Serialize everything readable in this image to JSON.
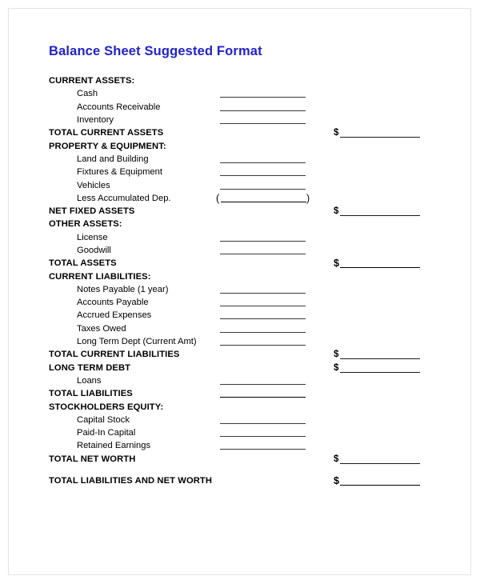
{
  "document": {
    "title": "Balance Sheet Suggested Format",
    "title_color": "#2222CC",
    "currency_symbol": "$"
  },
  "rows": [
    {
      "label": "CURRENT ASSETS:",
      "kind": "header",
      "field": "none"
    },
    {
      "label": "Cash",
      "kind": "item",
      "field": "inner"
    },
    {
      "label": "Accounts Receivable",
      "kind": "item",
      "field": "inner"
    },
    {
      "label": "Inventory",
      "kind": "item",
      "field": "inner"
    },
    {
      "label": "TOTAL CURRENT ASSETS",
      "kind": "total",
      "field": "money"
    },
    {
      "label": "PROPERTY & EQUIPMENT:",
      "kind": "header",
      "field": "none"
    },
    {
      "label": "Land and Building",
      "kind": "item",
      "field": "inner"
    },
    {
      "label": "Fixtures & Equipment",
      "kind": "item",
      "field": "inner"
    },
    {
      "label": "Vehicles",
      "kind": "item",
      "field": "inner"
    },
    {
      "label": "Less Accumulated Dep.",
      "kind": "item",
      "field": "paren"
    },
    {
      "label": "NET FIXED ASSETS",
      "kind": "total",
      "field": "money"
    },
    {
      "label": "OTHER ASSETS:",
      "kind": "header",
      "field": "none"
    },
    {
      "label": "License",
      "kind": "item",
      "field": "inner"
    },
    {
      "label": "Goodwill",
      "kind": "item",
      "field": "inner"
    },
    {
      "label": "TOTAL ASSETS",
      "kind": "total",
      "field": "money-strong"
    },
    {
      "label": "CURRENT LIABILITIES:",
      "kind": "header",
      "field": "none"
    },
    {
      "label": "Notes Payable (1 year)",
      "kind": "item",
      "field": "inner"
    },
    {
      "label": "Accounts Payable",
      "kind": "item",
      "field": "inner"
    },
    {
      "label": "Accrued Expenses",
      "kind": "item",
      "field": "inner"
    },
    {
      "label": "Taxes Owed",
      "kind": "item",
      "field": "inner"
    },
    {
      "label": "Long Term Dept (Current Amt)",
      "kind": "item",
      "field": "inner"
    },
    {
      "label": "TOTAL CURRENT LIABILITIES",
      "kind": "total",
      "field": "money"
    },
    {
      "label": "LONG TERM DEBT",
      "kind": "total",
      "field": "money"
    },
    {
      "label": "Loans",
      "kind": "item",
      "field": "inner"
    },
    {
      "label": "TOTAL LIABILITIES",
      "kind": "total",
      "field": "inner-strong"
    },
    {
      "label": "STOCKHOLDERS EQUITY:",
      "kind": "header",
      "field": "none"
    },
    {
      "label": "Capital Stock",
      "kind": "item",
      "field": "inner"
    },
    {
      "label": "Paid-In Capital",
      "kind": "item",
      "field": "inner"
    },
    {
      "label": "Retained Earnings",
      "kind": "item",
      "field": "inner"
    },
    {
      "label": "TOTAL NET WORTH",
      "kind": "total",
      "field": "money"
    },
    {
      "label": "TOTAL LIABILITIES AND NET WORTH",
      "kind": "total",
      "field": "money-strong",
      "gap_before": true
    }
  ]
}
